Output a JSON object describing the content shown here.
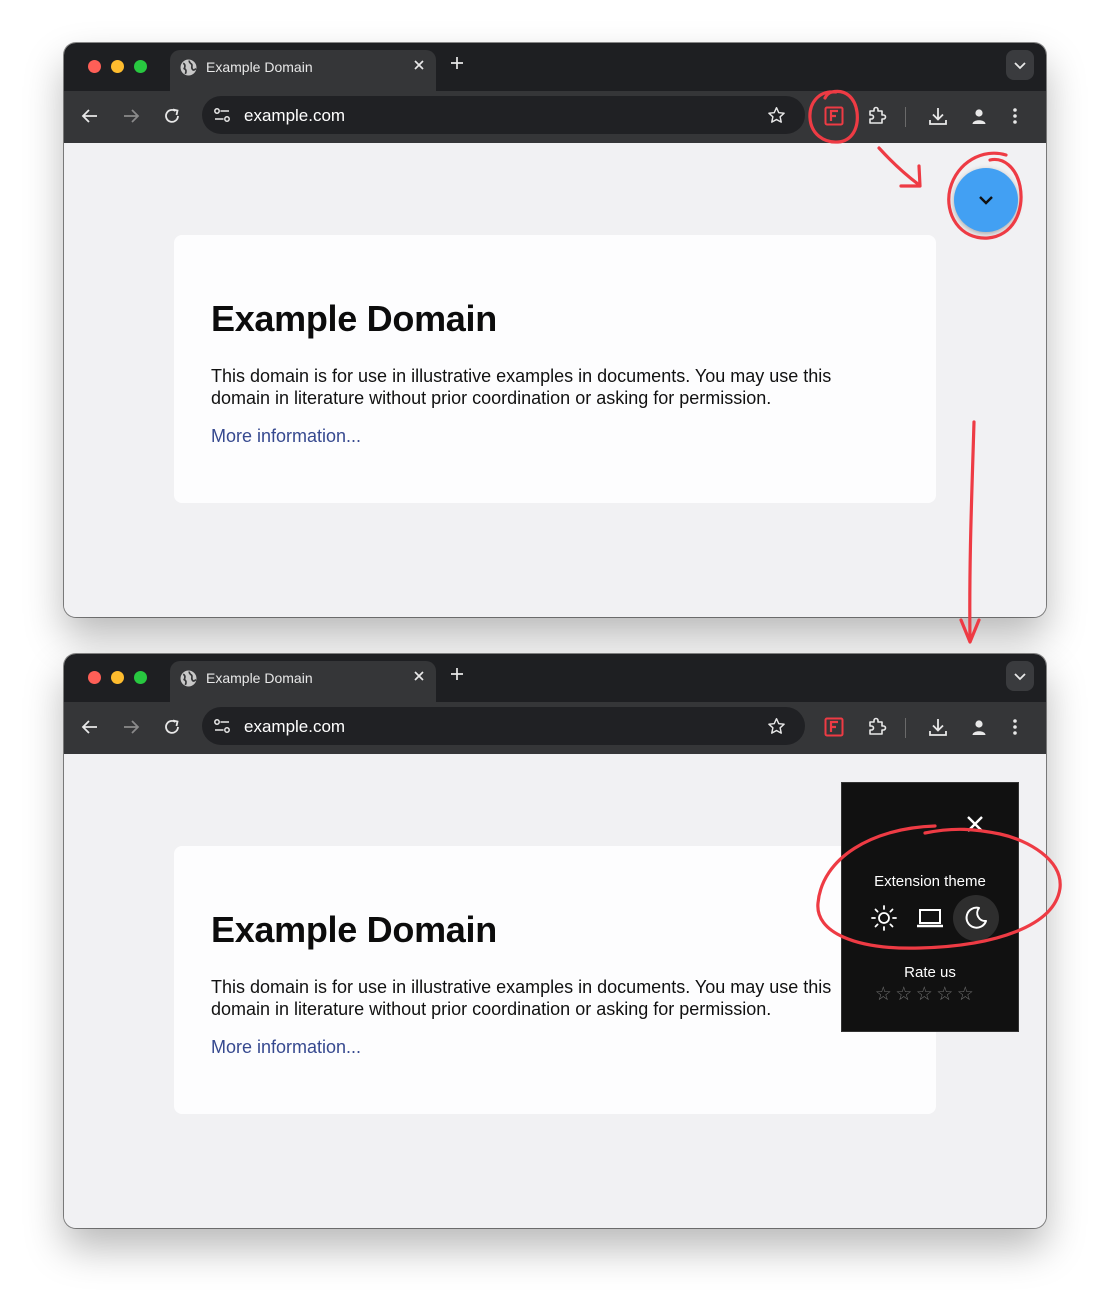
{
  "colors": {
    "close_dot": "#fe5f57",
    "minimize_dot": "#febc2e",
    "zoom_dot": "#28c840",
    "annotation": "#ee3b44",
    "fab": "#42a0f3",
    "link": "#36498f"
  },
  "windows": [
    {
      "tab": {
        "title": "Example Domain",
        "close": "✕",
        "new_tab": "+"
      },
      "omnibox": {
        "url": "example.com"
      },
      "page": {
        "heading": "Example Domain",
        "body": "This domain is for use in illustrative examples in documents. You may use this domain in literature without prior coordination or asking for permission.",
        "link": "More information..."
      }
    },
    {
      "tab": {
        "title": "Example Domain",
        "close": "✕",
        "new_tab": "+"
      },
      "omnibox": {
        "url": "example.com"
      },
      "page": {
        "heading": "Example Domain",
        "body": "This domain is for use in illustrative examples in documents. You may use this domain in literature without prior coordination or asking for permission.",
        "link": "More information..."
      },
      "popup": {
        "theme_label": "Extension theme",
        "theme_options": [
          "sun-icon",
          "laptop-icon",
          "moon-icon"
        ],
        "selected_theme": "moon-icon",
        "rate_label": "Rate us",
        "stars": [
          "☆",
          "☆",
          "☆",
          "☆",
          "☆"
        ]
      }
    }
  ],
  "icons": {
    "extension_badge": "F"
  }
}
